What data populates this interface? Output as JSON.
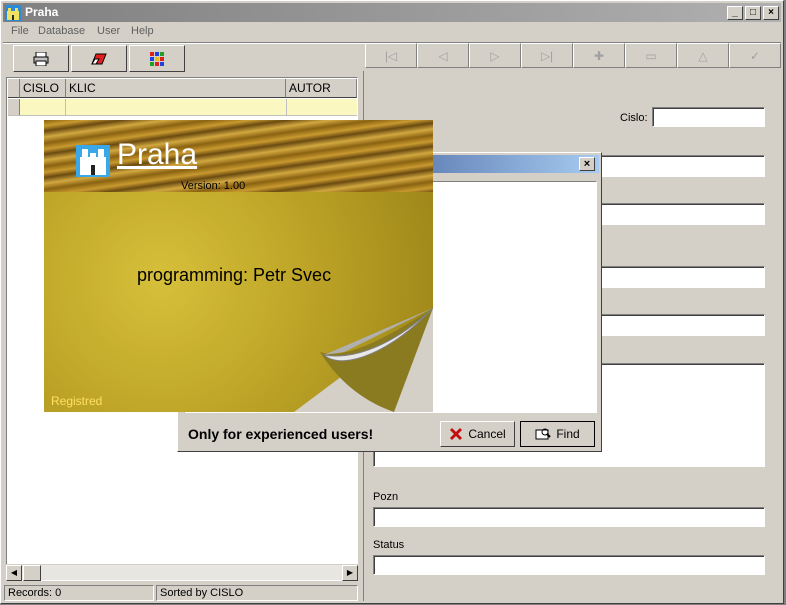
{
  "window": {
    "title": "Praha"
  },
  "menu": [
    "File",
    "Database",
    "User",
    "Help"
  ],
  "grid": {
    "columns": [
      "CISLO",
      "KLIC",
      "AUTOR"
    ]
  },
  "status": {
    "records": "Records: 0",
    "sorted": "Sorted by CISLO"
  },
  "form": {
    "cislo_label": "Cislo:",
    "pozn_label": "Pozn",
    "status_label": "Status"
  },
  "dialog": {
    "message": "Only for experienced users!",
    "cancel_label": "Cancel",
    "find_label": "Find"
  },
  "splash": {
    "title": "Praha",
    "version": "Version: 1.00",
    "programming": "programming: Petr Svec",
    "registered": "Registred"
  }
}
